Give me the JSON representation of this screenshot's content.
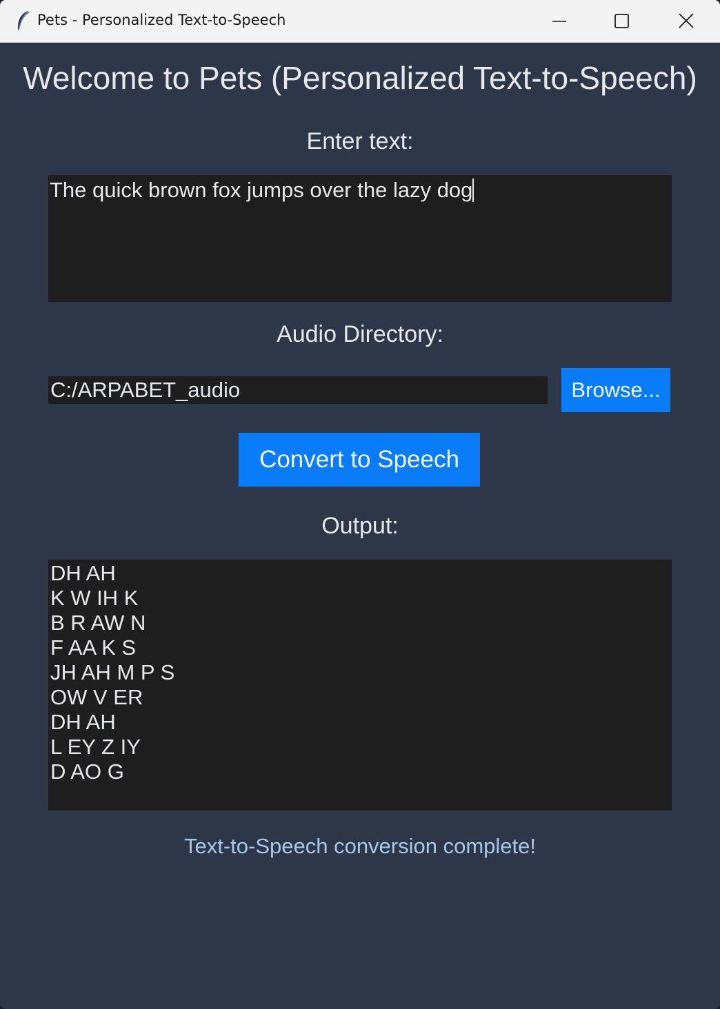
{
  "window": {
    "title": "Pets - Personalized Text-to-Speech",
    "icon": "feather-icon"
  },
  "heading": "Welcome to Pets (Personalized Text-to-Speech)",
  "text_section": {
    "label": "Enter text:",
    "value": "The quick brown fox jumps over the lazy dog"
  },
  "audio_section": {
    "label": "Audio Directory:",
    "value": "C:/ARPABET_audio",
    "browse_label": "Browse..."
  },
  "convert_label": "Convert to Speech",
  "output_section": {
    "label": "Output:",
    "lines": [
      "DH AH",
      "K W IH K",
      "B R AW N",
      "F AA K S",
      "JH AH M P S",
      "OW V ER",
      "DH AH",
      "L EY Z IY",
      "D AO G"
    ]
  },
  "status": "Text-to-Speech conversion complete!",
  "colors": {
    "background": "#2e3748",
    "field": "#1e1e1e",
    "accent": "#0a7cf7",
    "status_text": "#a9c8e6"
  }
}
